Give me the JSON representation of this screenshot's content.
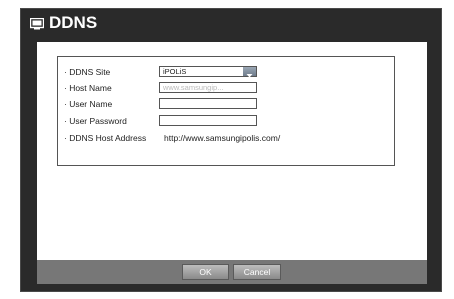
{
  "window": {
    "title": "DDNS",
    "title_icon": "monitor-icon"
  },
  "form": {
    "ddns_site": {
      "label": "· DDNS Site",
      "value": "iPOLiS"
    },
    "host_name": {
      "label": "· Host Name",
      "value": "www.samsungip..."
    },
    "user_name": {
      "label": "· User Name",
      "value": ""
    },
    "user_password": {
      "label": "· User Password",
      "value": ""
    },
    "ddns_host_address": {
      "label": "· DDNS Host Address",
      "value": "http://www.samsungipolis.com/"
    }
  },
  "buttons": {
    "ok": "OK",
    "cancel": "Cancel"
  },
  "colors": {
    "frame": "#2a2a2a",
    "footer": "#777777",
    "button": "#a0a0a0"
  }
}
